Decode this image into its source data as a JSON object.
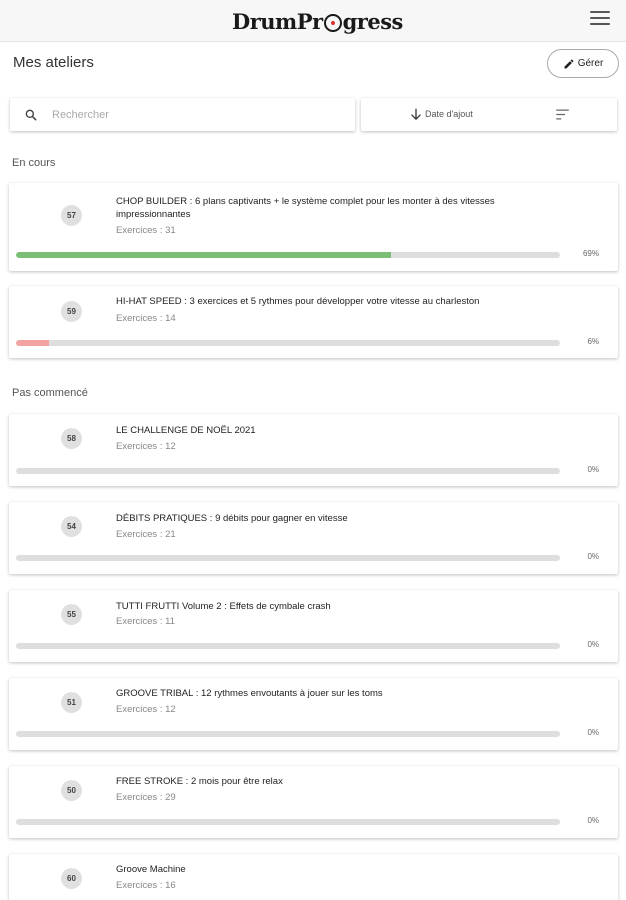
{
  "header": {
    "brand": "DrumProgress"
  },
  "page": {
    "title": "Mes ateliers",
    "manage_label": "Gérer"
  },
  "toolbar": {
    "search_placeholder": "Rechercher",
    "sort_label": "Date d'ajout"
  },
  "sections": {
    "in_progress": "En cours",
    "not_started": "Pas commencé"
  },
  "workshops": [
    {
      "number": "57",
      "title": "CHOP BUILDER : 6 plans captivants + le système complet pour les monter à des vitesses impressionnantes",
      "exercises": "Exercices : 31",
      "progress": 69,
      "progress_label": "69%",
      "color": "#7bbf77"
    },
    {
      "number": "59",
      "title": "HI-HAT SPEED : 3 exercices et 5 rythmes pour développer votre vitesse au charleston",
      "exercises": "Exercices : 14",
      "progress": 6,
      "progress_label": "6%",
      "color": "#f4a3a3"
    },
    {
      "number": "58",
      "title": "LE CHALLENGE DE NOËL 2021",
      "exercises": "Exercices : 12",
      "progress": 0,
      "progress_label": "0%",
      "color": "#dedede"
    },
    {
      "number": "54",
      "title": "DÉBITS PRATIQUES : 9 débits pour gagner en vitesse",
      "exercises": "Exercices : 21",
      "progress": 0,
      "progress_label": "0%",
      "color": "#dedede"
    },
    {
      "number": "55",
      "title": "TUTTI FRUTTI Volume 2 : Effets de cymbale crash",
      "exercises": "Exercices : 11",
      "progress": 0,
      "progress_label": "0%",
      "color": "#dedede"
    },
    {
      "number": "51",
      "title": "GROOVE TRIBAL : 12 rythmes envoutants à jouer sur les toms",
      "exercises": "Exercices : 12",
      "progress": 0,
      "progress_label": "0%",
      "color": "#dedede"
    },
    {
      "number": "50",
      "title": "FREE STROKE : 2 mois pour être relax",
      "exercises": "Exercices : 29",
      "progress": 0,
      "progress_label": "0%",
      "color": "#dedede"
    },
    {
      "number": "60",
      "title": "Groove Machine",
      "exercises": "Exercices : 16",
      "progress": 0,
      "progress_label": "0%",
      "color": "#dedede"
    }
  ]
}
